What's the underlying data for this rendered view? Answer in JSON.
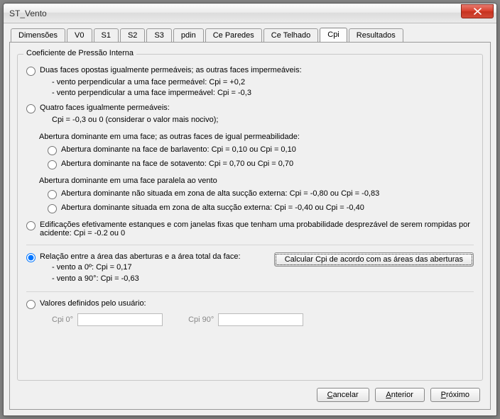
{
  "window": {
    "title": "ST_Vento"
  },
  "tabs": {
    "items": [
      {
        "label": "Dimensões"
      },
      {
        "label": "V0"
      },
      {
        "label": "S1"
      },
      {
        "label": "S2"
      },
      {
        "label": "S3"
      },
      {
        "label": "pdin"
      },
      {
        "label": "Ce Paredes"
      },
      {
        "label": "Ce Telhado"
      },
      {
        "label": "Cpi"
      },
      {
        "label": "Resultados"
      }
    ],
    "active_index": 8
  },
  "group": {
    "title": "Coeficiente de Pressão Interna",
    "options": {
      "duas_faces": {
        "label": "Duas faces opostas igualmente permeáveis; as outras faces impermeáveis:",
        "sub1": "- vento perpendicular a uma face permeável: Cpi = +0,2",
        "sub2": "- vento perpendicular a uma face impermeável: Cpi = -0,3"
      },
      "quatro_faces": {
        "label": "Quatro faces igualmente permeáveis:",
        "sub1": "Cpi = -0,3 ou 0 (considerar o valor mais nocivo);"
      },
      "abertura_uma_face": {
        "heading": "Abertura dominante em uma face; as outras faces de igual permeabilidade:",
        "barlavento": "Abertura dominante na face de barlavento: Cpi = 0,10 ou Cpi = 0,10",
        "sotavento": "Abertura dominante na face de sotavento: Cpi = 0,70 ou Cpi = 0,70"
      },
      "abertura_paralela": {
        "heading": "Abertura dominante em uma face paralela ao vento",
        "nao_situada": "Abertura dominante não situada em zona de alta sucção externa: Cpi = -0,80 ou Cpi = -0,83",
        "situada": "Abertura dominante situada em zona de alta sucção externa: Cpi = -0,40 ou Cpi = -0,40"
      },
      "estanques": {
        "label": "Edificações efetivamente estanques e com janelas fixas que tenham uma probabilidade desprezável de serem rompidas por acidente: Cpi = -0.2 ou 0"
      },
      "relacao": {
        "label": "Relação entre a área das aberturas e a área total da face:",
        "sub1": "- vento a 0º: Cpi = 0,17",
        "sub2": "- vento a 90°: Cpi = -0,63",
        "button": "Calcular Cpi de acordo com as áreas das aberturas"
      },
      "usuario": {
        "label": "Valores definidos pelo usuário:",
        "cpi0_label": "Cpi 0°",
        "cpi0_value": "",
        "cpi90_label": "Cpi 90°",
        "cpi90_value": ""
      }
    },
    "selected": "relacao"
  },
  "footer": {
    "cancel": "Cancelar",
    "prev": "Anterior",
    "next": "Próximo"
  }
}
